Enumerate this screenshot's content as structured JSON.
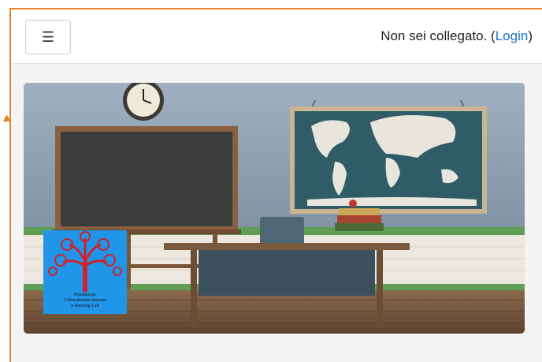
{
  "navbar": {
    "menu_icon": "☰",
    "login_prefix": "Non sei collegato. (",
    "login_link": "Login",
    "login_suffix": ")"
  },
  "hero": {
    "logo_caption_lines": [
      "Fondazione",
      "Culturalmente insieme",
      "e-learning Lab"
    ]
  },
  "colors": {
    "accent_border": "#e8822a",
    "link": "#1a73c8",
    "logo_bg": "#2196e8"
  }
}
